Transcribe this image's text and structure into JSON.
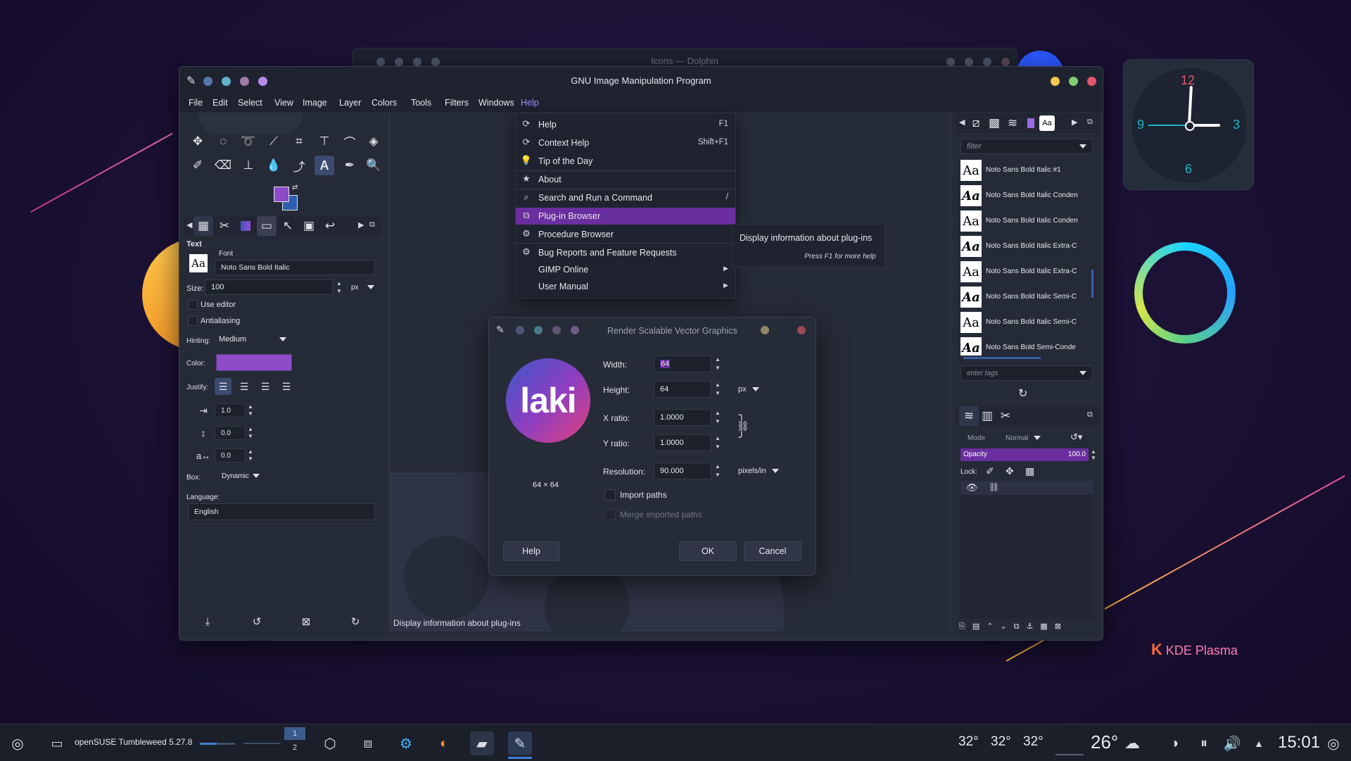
{
  "dolphin": {
    "title": "Icons — Dolphin"
  },
  "gimp": {
    "title": "GNU Image Manipulation Program",
    "menus": [
      "File",
      "Edit",
      "Select",
      "View",
      "Image",
      "Layer",
      "Colors",
      "Tools",
      "Filters",
      "Windows",
      "Help"
    ],
    "status": "Display information about plug-ins"
  },
  "help_menu": {
    "items": [
      {
        "icon": "help-icon",
        "label": "Help",
        "shortcut": "F1"
      },
      {
        "icon": "context-help-icon",
        "label": "Context Help",
        "shortcut": "Shift+F1"
      },
      {
        "icon": "lightbulb-icon",
        "label": "Tip of the Day",
        "shortcut": ""
      },
      {
        "icon": "star-icon",
        "label": "About",
        "shortcut": ""
      },
      {
        "icon": "search-icon",
        "label": "Search and Run a Command",
        "shortcut": "/"
      },
      {
        "icon": "plugin-icon",
        "label": "Plug-in Browser",
        "shortcut": ""
      },
      {
        "icon": "procedure-icon",
        "label": "Procedure Browser",
        "shortcut": ""
      },
      {
        "icon": "bug-icon",
        "label": "Bug Reports and Feature Requests",
        "shortcut": ""
      },
      {
        "icon": "",
        "label": "GIMP Online",
        "shortcut": ""
      },
      {
        "icon": "",
        "label": "User Manual",
        "shortcut": ""
      }
    ]
  },
  "tooltip": {
    "text": "Display information about plug-ins",
    "hint": "Press F1 for more help"
  },
  "tool_options": {
    "section": "Text",
    "font_label": "Font",
    "font_value": "Noto Sans Bold Italic",
    "font_swatch": "Aa",
    "size_label": "Size:",
    "size_value": "100",
    "size_unit": "px",
    "use_editor": "Use editor",
    "antialiasing": "Antialiasing",
    "hinting_label": "Hinting:",
    "hinting_value": "Medium",
    "color_label": "Color:",
    "color_value": "#8e4bc7",
    "justify_label": "Justify:",
    "indent": "1.0",
    "line_spacing": "0.0",
    "letter_spacing": "0.0",
    "box_label": "Box:",
    "box_value": "Dynamic",
    "language_label": "Language:",
    "language_value": "English"
  },
  "fonts_panel": {
    "filter_placeholder": "filter",
    "tags_placeholder": "enter tags",
    "swatch_tab": "Aa",
    "fonts": [
      {
        "swatch": "Aa",
        "name": "Noto Sans Bold Italic #1"
      },
      {
        "swatch": "Aa",
        "name": "Noto Sans Bold Italic Conden"
      },
      {
        "swatch": "Aa",
        "name": "Noto Sans Bold Italic Conden"
      },
      {
        "swatch": "Aa",
        "name": "Noto Sans Bold Italic Extra-C"
      },
      {
        "swatch": "Aa",
        "name": "Noto Sans Bold Italic Extra-C"
      },
      {
        "swatch": "Aa",
        "name": "Noto Sans Bold Italic Semi-C"
      },
      {
        "swatch": "Aa",
        "name": "Noto Sans Bold Italic Semi-C"
      },
      {
        "swatch": "Aa",
        "name": "Noto Sans Bold Semi-Conde"
      }
    ]
  },
  "layers_panel": {
    "mode_label": "Mode",
    "mode_value": "Normal",
    "opacity_label": "Opacity",
    "opacity_value": "100.0",
    "lock_label": "Lock:"
  },
  "svg_dialog": {
    "title": "Render Scalable Vector Graphics",
    "preview_text": "laki",
    "preview_size": "64 × 64",
    "width_label": "Width:",
    "width_value": "64",
    "height_label": "Height:",
    "height_value": "64",
    "unit": "px",
    "xratio_label": "X ratio:",
    "xratio_value": "1.0000",
    "yratio_label": "Y ratio:",
    "yratio_value": "1.0000",
    "resolution_label": "Resolution:",
    "resolution_value": "90.000",
    "resolution_unit": "pixels/in",
    "import_paths": "Import paths",
    "merge_paths": "Merge imported paths",
    "help_btn": "Help",
    "ok_btn": "OK",
    "cancel_btn": "Cancel"
  },
  "clock": {
    "n12": "12",
    "n3": "3",
    "n6": "6",
    "n9": "9"
  },
  "kde": {
    "logo": "K",
    "label": "KDE Plasma"
  },
  "taskbar": {
    "app_title": "openSUSE Tumbleweed 5.27.8",
    "desktop1": "1",
    "desktop2": "2",
    "temps": [
      "32°",
      "32°",
      "32°"
    ],
    "weather": "26°",
    "time": "15:01"
  },
  "colors": {
    "accent": "#6a2e9e",
    "highlight_text": "#9b8cff",
    "fg_color": "#8e4bc7",
    "bg_color": "#2f5fb0"
  }
}
